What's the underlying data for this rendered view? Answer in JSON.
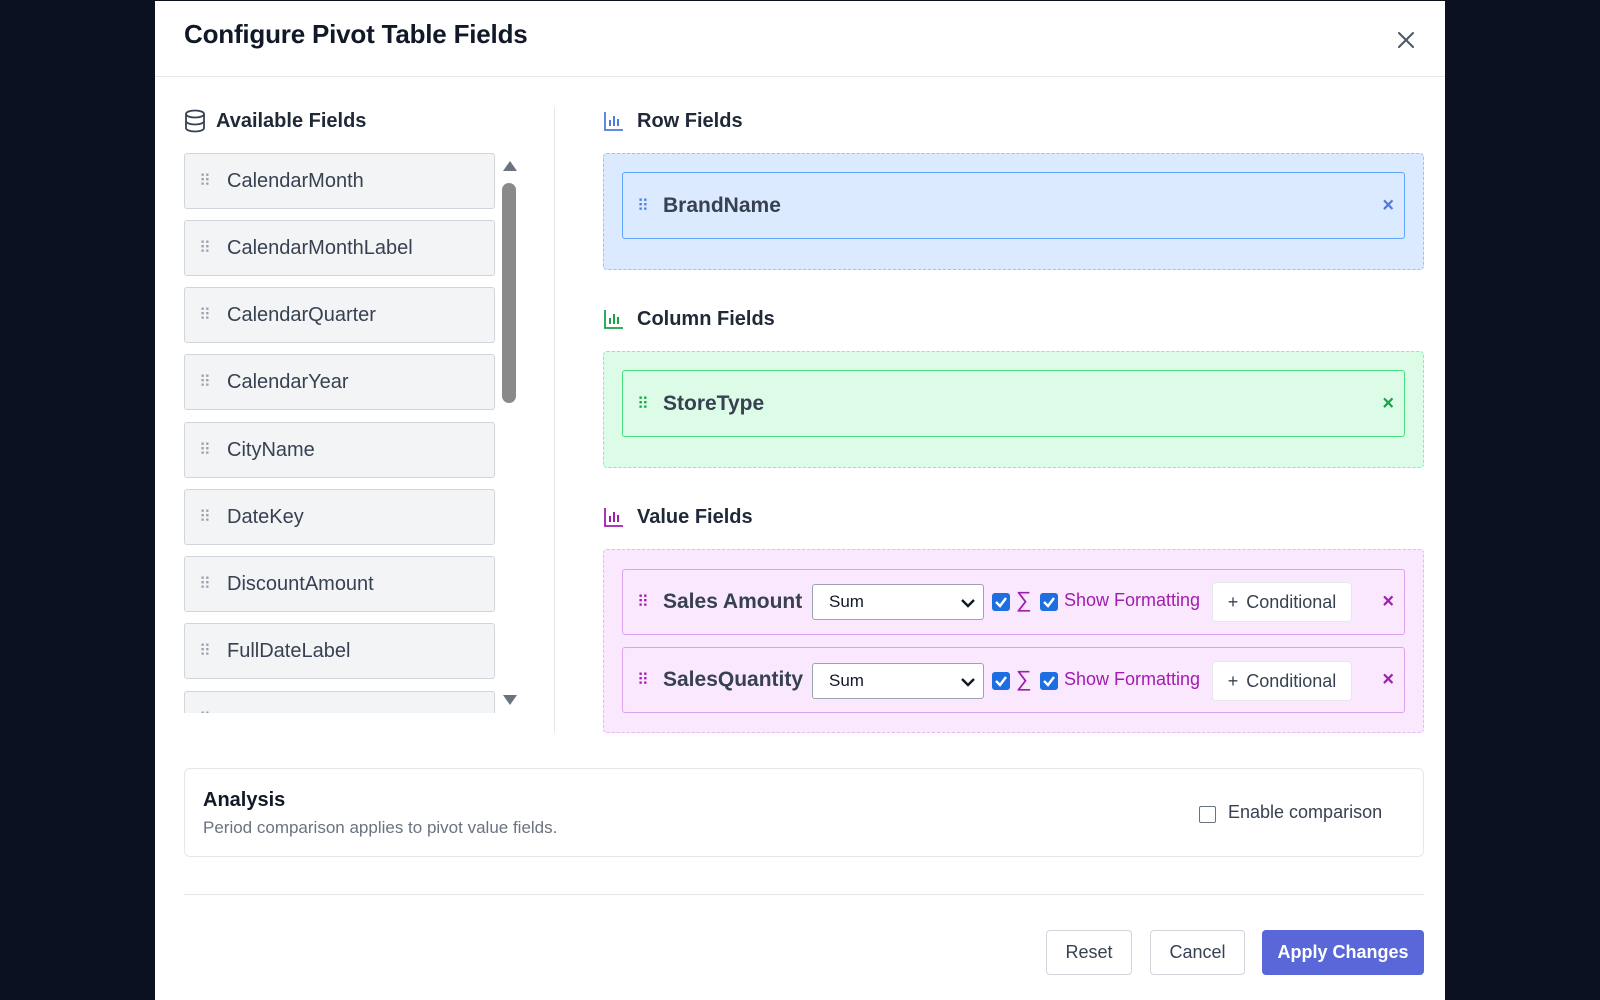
{
  "dialog": {
    "title": "Configure Pivot Table Fields",
    "close_icon": "close-icon"
  },
  "available": {
    "title": "Available Fields",
    "icon": "database-icon",
    "fields": [
      "CalendarMonth",
      "CalendarMonthLabel",
      "CalendarQuarter",
      "CalendarYear",
      "CityName",
      "DateKey",
      "DiscountAmount",
      "FullDateLabel"
    ]
  },
  "rows": {
    "title": "Row Fields",
    "icon": "bar-chart-icon",
    "color": "#4f7be0",
    "items": [
      {
        "label": "BrandName"
      }
    ]
  },
  "columns": {
    "title": "Column Fields",
    "icon": "bar-chart-icon",
    "color": "#16a34a",
    "items": [
      {
        "label": "StoreType"
      }
    ]
  },
  "values": {
    "title": "Value Fields",
    "icon": "bar-chart-icon",
    "color": "#a21caf",
    "items": [
      {
        "label": "Sales Amount",
        "aggregation": "Sum",
        "sum_checked": true,
        "sigma": "∑",
        "format_checked": true,
        "format_label": "Show Formatting",
        "conditional_label": "Conditional"
      },
      {
        "label": "SalesQuantity",
        "aggregation": "Sum",
        "sum_checked": true,
        "sigma": "∑",
        "format_checked": true,
        "format_label": "Show Formatting",
        "conditional_label": "Conditional"
      }
    ]
  },
  "analysis": {
    "title": "Analysis",
    "subtitle": "Period comparison applies to pivot value fields.",
    "compare_label": "Enable comparison",
    "compare_checked": false
  },
  "footer": {
    "reset_label": "Reset",
    "cancel_label": "Cancel",
    "apply_label": "Apply Changes"
  }
}
